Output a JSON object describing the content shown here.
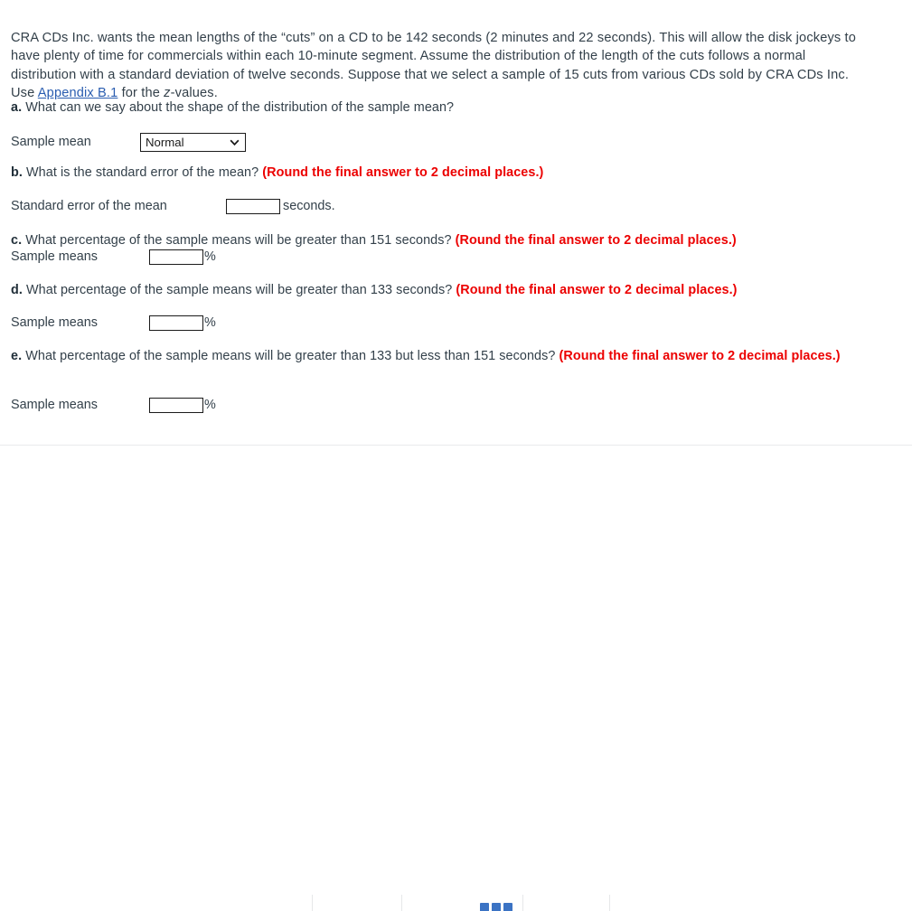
{
  "intro": {
    "part1": "CRA CDs Inc. wants the mean lengths of the “cuts” on a CD to be 142 seconds (2 minutes and 22 seconds). This will allow the disk jockeys to have plenty of time for commercials within each 10-minute segment. Assume the distribution of the length of the cuts follows a normal distribution with a standard deviation of twelve seconds. Suppose that we select a sample of 15 cuts from various CDs sold by CRA CDs Inc. Use ",
    "link_text": "Appendix B.1",
    "part2_pre": " for the ",
    "part2_italic": "z",
    "part2_post": "-values."
  },
  "questions": {
    "a": {
      "label": "a.",
      "text": " What can we say about the shape of the distribution of the sample mean?",
      "answer_caption": "Sample mean",
      "select_value": "Normal",
      "select_options": [
        "Normal"
      ]
    },
    "b": {
      "label": "b.",
      "text": " What is the standard error of the mean? ",
      "note": "(Round the final answer to 2 decimal places.)",
      "answer_caption": "Standard error of the mean",
      "input_value": "",
      "unit": "seconds."
    },
    "c": {
      "label": "c.",
      "text": " What percentage of the sample means will be greater than 151 seconds? ",
      "note": "(Round the final answer to 2 decimal places.)",
      "answer_caption": "Sample means",
      "input_value": "",
      "unit": "%"
    },
    "d": {
      "label": "d.",
      "text": " What percentage of the sample means will be greater than 133 seconds? ",
      "note": "(Round the final answer to 2 decimal places.)",
      "answer_caption": "Sample means",
      "input_value": "",
      "unit": "%"
    },
    "e": {
      "label": "e.",
      "text": " What percentage of the sample means will be greater than 133 but less than 151 seconds? ",
      "note": "(Round the final answer to 2 decimal places.)",
      "answer_caption": "Sample means",
      "input_value": "",
      "unit": "%"
    }
  },
  "colors": {
    "note_red": "#ec0000",
    "link_blue": "#2a5db0",
    "body_text": "#33404a",
    "accent_blue": "#3b73c4"
  }
}
